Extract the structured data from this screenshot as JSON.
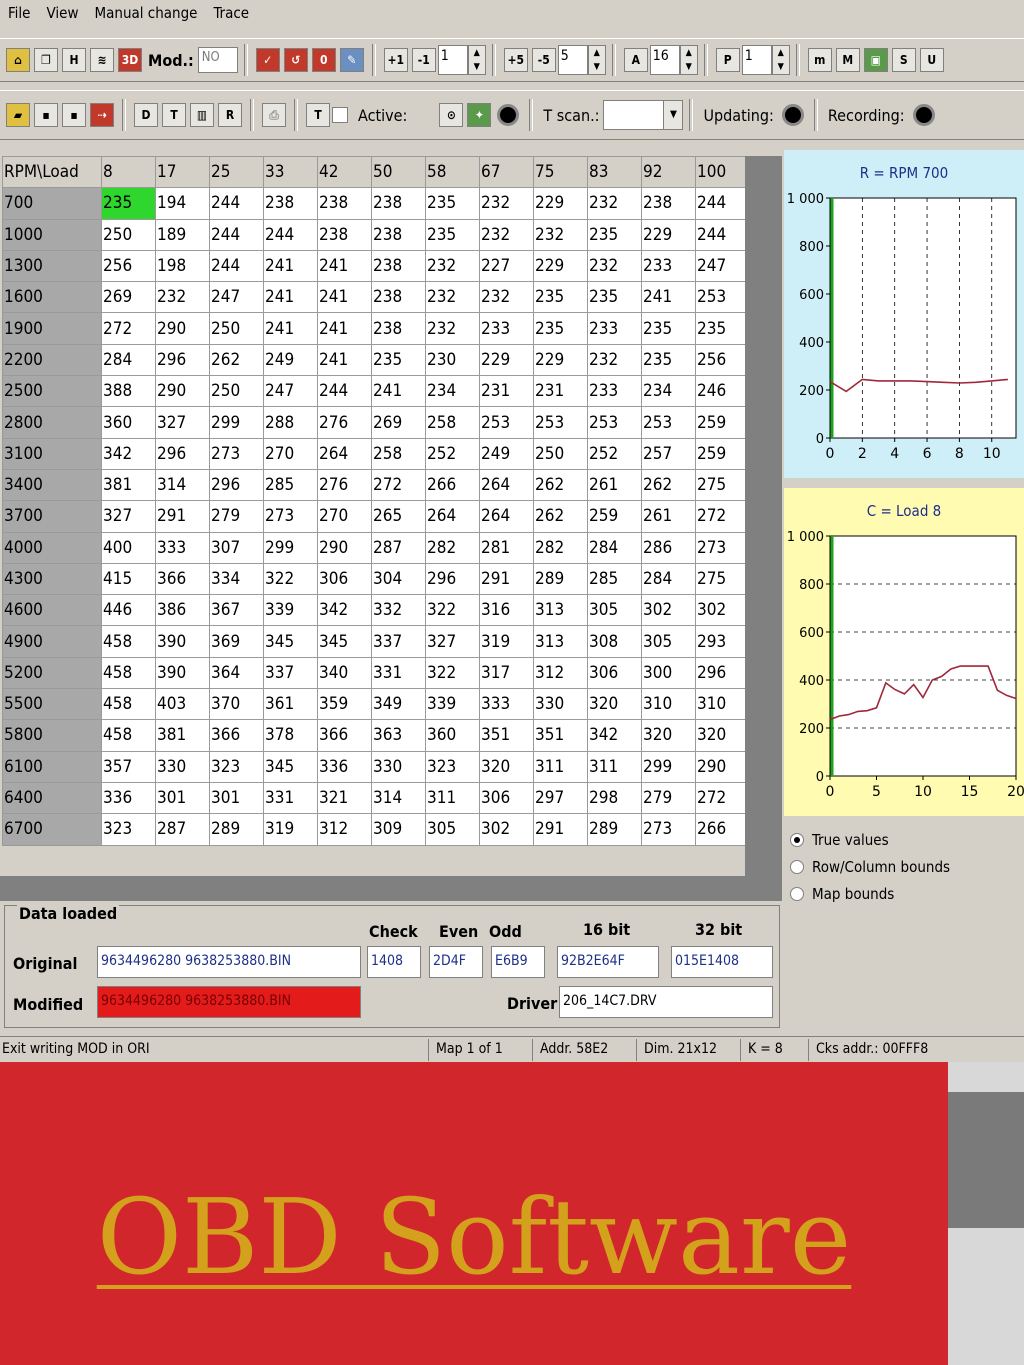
{
  "menu": {
    "items": [
      "File",
      "View",
      "Manual change",
      "Trace"
    ]
  },
  "toolbar1": {
    "mod_label": "Mod.:",
    "mod_value": "NO",
    "spin1": "1",
    "spin2": "5",
    "spin3": "16",
    "spin4": "1"
  },
  "toolbar2": {
    "active_label": "Active:",
    "tscan_label": "T scan.:",
    "updating_label": "Updating:",
    "recording_label": "Recording:"
  },
  "map_table": {
    "corner": "RPM\\Load",
    "columns": [
      "8",
      "17",
      "25",
      "33",
      "42",
      "50",
      "58",
      "67",
      "75",
      "83",
      "92",
      "100"
    ],
    "rows": [
      {
        "rpm": "700",
        "values": [
          "235",
          "194",
          "244",
          "238",
          "238",
          "238",
          "235",
          "232",
          "229",
          "232",
          "238",
          "244"
        ]
      },
      {
        "rpm": "1000",
        "values": [
          "250",
          "189",
          "244",
          "244",
          "238",
          "238",
          "235",
          "232",
          "232",
          "235",
          "229",
          "244"
        ]
      },
      {
        "rpm": "1300",
        "values": [
          "256",
          "198",
          "244",
          "241",
          "241",
          "238",
          "232",
          "227",
          "229",
          "232",
          "233",
          "247"
        ]
      },
      {
        "rpm": "1600",
        "values": [
          "269",
          "232",
          "247",
          "241",
          "241",
          "238",
          "232",
          "232",
          "235",
          "235",
          "241",
          "253"
        ]
      },
      {
        "rpm": "1900",
        "values": [
          "272",
          "290",
          "250",
          "241",
          "241",
          "238",
          "232",
          "233",
          "235",
          "233",
          "235",
          "235"
        ]
      },
      {
        "rpm": "2200",
        "values": [
          "284",
          "296",
          "262",
          "249",
          "241",
          "235",
          "230",
          "229",
          "229",
          "232",
          "235",
          "256"
        ]
      },
      {
        "rpm": "2500",
        "values": [
          "388",
          "290",
          "250",
          "247",
          "244",
          "241",
          "234",
          "231",
          "231",
          "233",
          "234",
          "246"
        ]
      },
      {
        "rpm": "2800",
        "values": [
          "360",
          "327",
          "299",
          "288",
          "276",
          "269",
          "258",
          "253",
          "253",
          "253",
          "253",
          "259"
        ]
      },
      {
        "rpm": "3100",
        "values": [
          "342",
          "296",
          "273",
          "270",
          "264",
          "258",
          "252",
          "249",
          "250",
          "252",
          "257",
          "259"
        ]
      },
      {
        "rpm": "3400",
        "values": [
          "381",
          "314",
          "296",
          "285",
          "276",
          "272",
          "266",
          "264",
          "262",
          "261",
          "262",
          "275"
        ]
      },
      {
        "rpm": "3700",
        "values": [
          "327",
          "291",
          "279",
          "273",
          "270",
          "265",
          "264",
          "264",
          "262",
          "259",
          "261",
          "272"
        ]
      },
      {
        "rpm": "4000",
        "values": [
          "400",
          "333",
          "307",
          "299",
          "290",
          "287",
          "282",
          "281",
          "282",
          "284",
          "286",
          "273"
        ]
      },
      {
        "rpm": "4300",
        "values": [
          "415",
          "366",
          "334",
          "322",
          "306",
          "304",
          "296",
          "291",
          "289",
          "285",
          "284",
          "275"
        ]
      },
      {
        "rpm": "4600",
        "values": [
          "446",
          "386",
          "367",
          "339",
          "342",
          "332",
          "322",
          "316",
          "313",
          "305",
          "302",
          "302"
        ]
      },
      {
        "rpm": "4900",
        "values": [
          "458",
          "390",
          "369",
          "345",
          "345",
          "337",
          "327",
          "319",
          "313",
          "308",
          "305",
          "293"
        ]
      },
      {
        "rpm": "5200",
        "values": [
          "458",
          "390",
          "364",
          "337",
          "340",
          "331",
          "322",
          "317",
          "312",
          "306",
          "300",
          "296"
        ]
      },
      {
        "rpm": "5500",
        "values": [
          "458",
          "403",
          "370",
          "361",
          "359",
          "349",
          "339",
          "333",
          "330",
          "320",
          "310",
          "310"
        ]
      },
      {
        "rpm": "5800",
        "values": [
          "458",
          "381",
          "366",
          "378",
          "366",
          "363",
          "360",
          "351",
          "351",
          "342",
          "320",
          "320"
        ]
      },
      {
        "rpm": "6100",
        "values": [
          "357",
          "330",
          "323",
          "345",
          "336",
          "330",
          "323",
          "320",
          "311",
          "311",
          "299",
          "290"
        ]
      },
      {
        "rpm": "6400",
        "values": [
          "336",
          "301",
          "301",
          "331",
          "321",
          "314",
          "311",
          "306",
          "297",
          "298",
          "279",
          "272"
        ]
      },
      {
        "rpm": "6700",
        "values": [
          "323",
          "287",
          "289",
          "319",
          "312",
          "309",
          "305",
          "302",
          "291",
          "289",
          "273",
          "266"
        ]
      }
    ]
  },
  "chart_data": [
    {
      "type": "line",
      "title": "R = RPM 700",
      "x": [
        0,
        1,
        2,
        3,
        4,
        5,
        6,
        7,
        8,
        9,
        10,
        11
      ],
      "series": [
        {
          "values": [
            235,
            194,
            244,
            238,
            238,
            238,
            235,
            232,
            229,
            232,
            238,
            244
          ]
        }
      ],
      "xlim": [
        0,
        11.5
      ],
      "ylim": [
        0,
        1000
      ],
      "xticks": [
        "0",
        "2",
        "4",
        "6",
        "8",
        "10"
      ],
      "yticks": [
        "0",
        "200",
        "400",
        "600",
        "800",
        "1 000"
      ],
      "grid": "vertical dashed",
      "colors": {
        "background": "#cfeff8",
        "line": "#a0283a",
        "cursor": "#1fa31f"
      }
    },
    {
      "type": "line",
      "title": "C = Load 8",
      "x": [
        0,
        1,
        2,
        3,
        4,
        5,
        6,
        7,
        8,
        9,
        10,
        11,
        12,
        13,
        14,
        15,
        16,
        17,
        18,
        19,
        20
      ],
      "series": [
        {
          "values": [
            235,
            250,
            256,
            269,
            272,
            284,
            388,
            360,
            342,
            381,
            327,
            400,
            415,
            446,
            458,
            458,
            458,
            458,
            357,
            336,
            323
          ]
        }
      ],
      "xlim": [
        0,
        20
      ],
      "ylim": [
        0,
        1000
      ],
      "xticks": [
        "0",
        "5",
        "10",
        "15",
        "20"
      ],
      "yticks": [
        "0",
        "200",
        "400",
        "600",
        "800",
        "1 000"
      ],
      "grid": "horizontal dashed",
      "colors": {
        "background": "#fffbb0",
        "line": "#a0283a",
        "cursor": "#1fa31f"
      }
    }
  ],
  "radios": {
    "options": [
      "True values",
      "Row/Column bounds",
      "Map bounds"
    ],
    "selected": 0
  },
  "data_panel": {
    "legend": "Data loaded",
    "original_label": "Original",
    "modified_label": "Modified",
    "original_file": "9634496280 9638253880.BIN",
    "modified_file": "9634496280 9638253880.BIN",
    "check_label": "Check",
    "even_label": "Even",
    "odd_label": "Odd",
    "bit16_label": "16 bit",
    "bit32_label": "32 bit",
    "check_value": "1408",
    "even_value": "2D4F",
    "odd_value": "E6B9",
    "bit16_value": "92B2E64F",
    "bit32_value": "015E1408",
    "driver_label": "Driver",
    "driver_value": "206_14C7.DRV"
  },
  "status": {
    "message": "Exit writing MOD in ORI",
    "map": "Map 1 of 1",
    "addr": "Addr. 58E2",
    "dim": "Dim. 21x12",
    "k": "K = 8",
    "cks": "Cks addr.: 00FFF8"
  },
  "banner": {
    "title": "OBD Software"
  },
  "colors": {
    "banner_bg": "#d1272c",
    "banner_text": "#d3a11c",
    "window_bg": "#d4d0c8",
    "selected_cell": "#2ed62e",
    "modified_field": "#e31b1b"
  }
}
